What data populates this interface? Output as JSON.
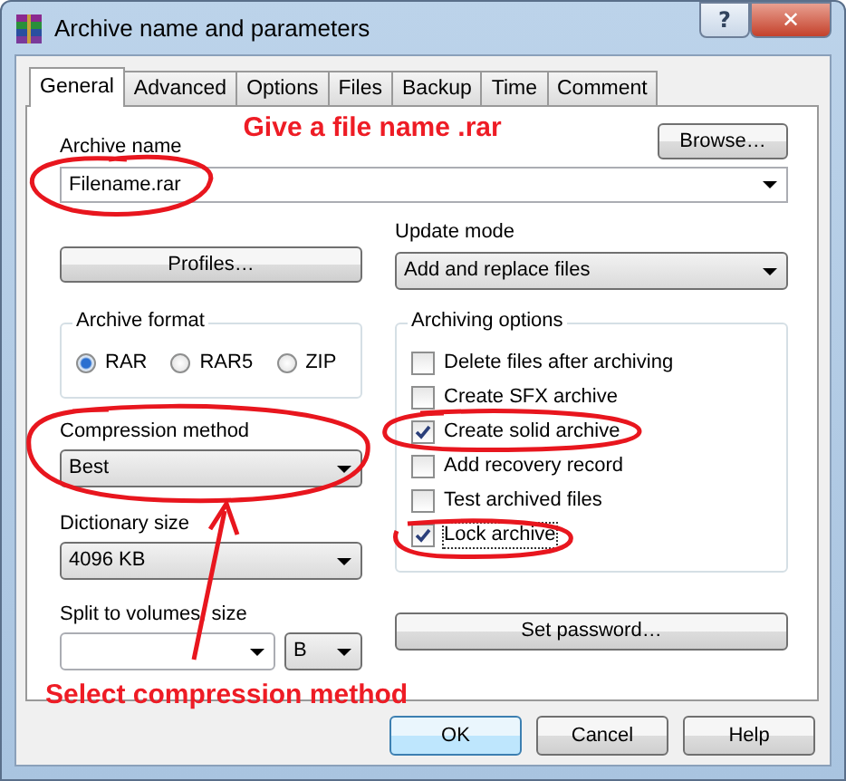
{
  "window": {
    "title": "Archive name and parameters"
  },
  "title_buttons": {
    "help": "?",
    "close": "✕"
  },
  "tabs": [
    {
      "label": "General",
      "selected": true
    },
    {
      "label": "Advanced",
      "selected": false
    },
    {
      "label": "Options",
      "selected": false
    },
    {
      "label": "Files",
      "selected": false
    },
    {
      "label": "Backup",
      "selected": false
    },
    {
      "label": "Time",
      "selected": false
    },
    {
      "label": "Comment",
      "selected": false
    }
  ],
  "archive_name": {
    "label": "Archive name",
    "value": "Filename.rar"
  },
  "browse_button": "Browse…",
  "profiles_button": "Profiles…",
  "update_mode": {
    "label": "Update mode",
    "value": "Add and replace files"
  },
  "archive_format": {
    "label": "Archive format",
    "options": [
      {
        "label": "RAR",
        "selected": true
      },
      {
        "label": "RAR5",
        "selected": false
      },
      {
        "label": "ZIP",
        "selected": false
      }
    ]
  },
  "compression_method": {
    "label": "Compression method",
    "value": "Best"
  },
  "dictionary_size": {
    "label": "Dictionary size",
    "value": "4096 KB"
  },
  "split_volumes": {
    "label": "Split to volumes, size",
    "unit": "B"
  },
  "archiving_options": {
    "label": "Archiving options",
    "options": [
      {
        "label": "Delete files after archiving",
        "checked": false,
        "focused": false
      },
      {
        "label": "Create SFX archive",
        "checked": false,
        "focused": false
      },
      {
        "label": "Create solid archive",
        "checked": true,
        "focused": false
      },
      {
        "label": "Add recovery record",
        "checked": false,
        "focused": false
      },
      {
        "label": "Test archived files",
        "checked": false,
        "focused": false
      },
      {
        "label": "Lock archive",
        "checked": true,
        "focused": true
      }
    ]
  },
  "set_password_button": "Set password…",
  "buttons": [
    {
      "label": "OK",
      "default": true
    },
    {
      "label": "Cancel",
      "default": false
    },
    {
      "label": "Help",
      "default": false
    }
  ],
  "annotations": {
    "top_note": "Give a file name .rar",
    "bottom_note": "Select compression method"
  }
}
